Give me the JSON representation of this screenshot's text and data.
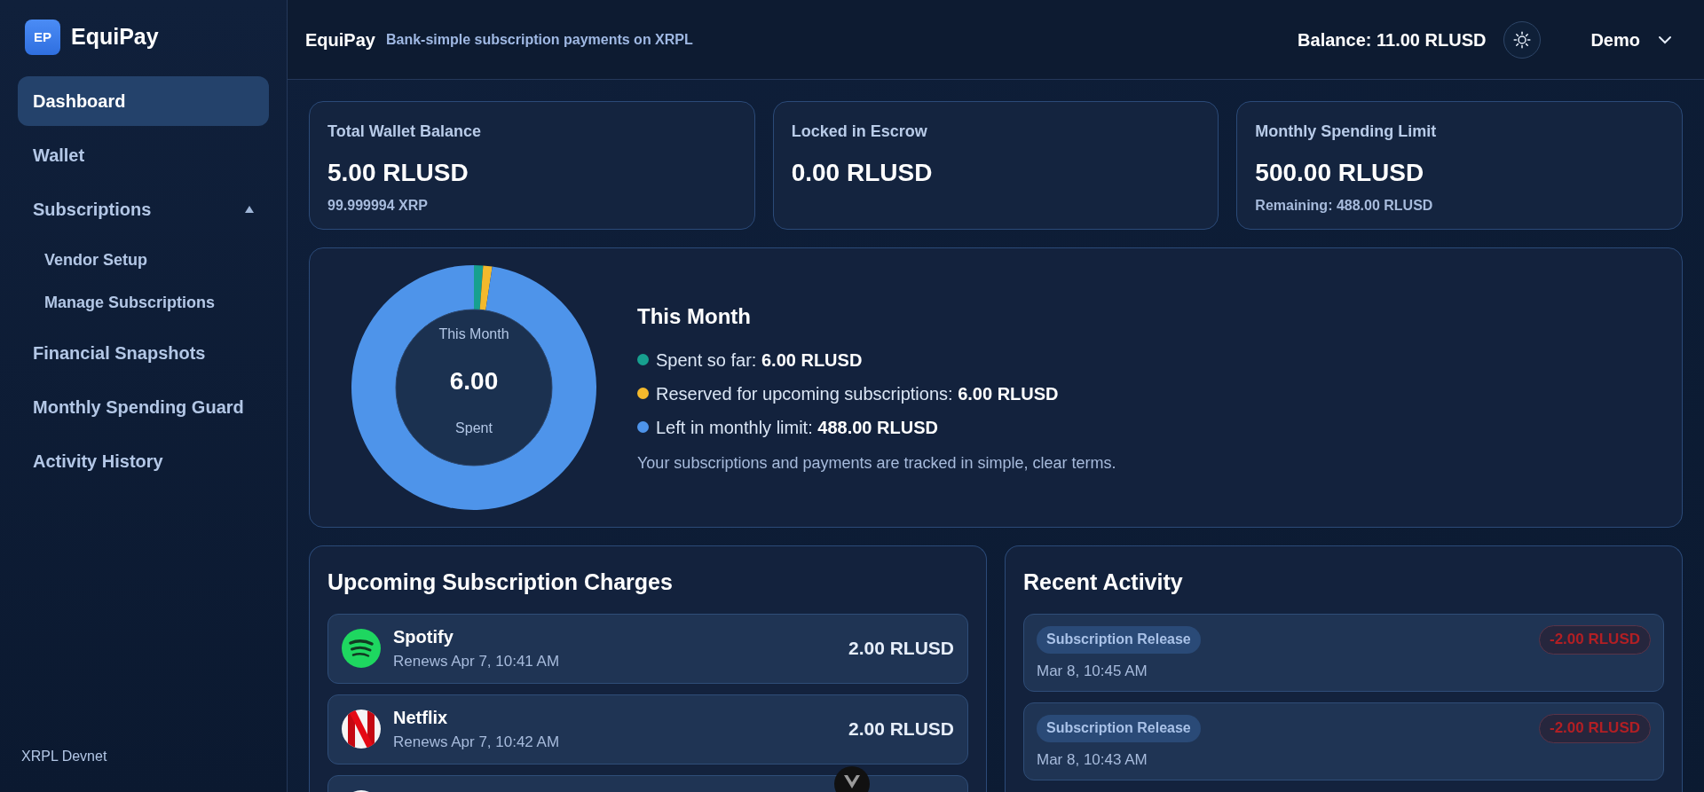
{
  "sidebar": {
    "logo_mark": "EP",
    "brand": "EquiPay",
    "items": [
      {
        "label": "Dashboard",
        "selected": true
      },
      {
        "label": "Wallet",
        "selected": false
      },
      {
        "label": "Subscriptions",
        "selected": false,
        "expanded": true,
        "children": [
          {
            "label": "Vendor Setup",
            "selected": false
          },
          {
            "label": "Manage Subscriptions",
            "selected": false
          }
        ]
      },
      {
        "label": "Financial Snapshots",
        "selected": false
      },
      {
        "label": "Monthly Spending Guard",
        "selected": false
      },
      {
        "label": "Activity History",
        "selected": false
      }
    ],
    "footer": "XRPL Devnet"
  },
  "header": {
    "brand": "EquiPay",
    "tagline": "Bank-simple subscription payments on XRPL",
    "balance": "Balance: 11.00 RLUSD",
    "user": "Demo"
  },
  "stat_cards": [
    {
      "title": "Total Wallet Balance",
      "value": "5.00 RLUSD",
      "sub": "99.999994 XRP"
    },
    {
      "title": "Locked in Escrow",
      "value": "0.00 RLUSD"
    },
    {
      "title": "Monthly Spending Limit",
      "value": "500.00 RLUSD",
      "sub": "Remaining: 488.00 RLUSD"
    }
  ],
  "month_summary": {
    "center_title": "This Month",
    "center_value": "6.00",
    "center_caption": "Spent",
    "chart_data": {
      "type": "donut",
      "values": [
        1.2,
        1.2,
        97.6
      ]
    },
    "title": "This Month",
    "legend": [
      {
        "label": "Spent so far:",
        "value": "6.00 RLUSD",
        "color": "#17a08f"
      },
      {
        "label": "Reserved for upcoming subscriptions:",
        "value": "6.00 RLUSD",
        "color": "#f4b92c"
      },
      {
        "label": "Left in monthly limit:",
        "value": "488.00 RLUSD",
        "color": "#4e94ea"
      }
    ],
    "note": "Your subscriptions and payments are tracked in simple, clear terms."
  },
  "upcoming": {
    "title": "Upcoming Subscription Charges",
    "items": [
      {
        "kind": "spotify",
        "name": "Spotify",
        "renews": "Renews Apr 7, 10:41 AM",
        "amount": "2.00 RLUSD"
      },
      {
        "kind": "netflix",
        "name": "Netflix",
        "renews": "Renews Apr 7, 10:42 AM",
        "amount": "2.00 RLUSD"
      },
      {
        "kind": "plain"
      }
    ]
  },
  "activity": {
    "title": "Recent Activity",
    "items": [
      {
        "type": "Subscription Release",
        "time": "Mar 8, 10:45 AM",
        "amount": "-2.00 RLUSD"
      },
      {
        "type": "Subscription Release",
        "time": "Mar 8, 10:43 AM",
        "amount": "-2.00 RLUSD"
      }
    ]
  }
}
